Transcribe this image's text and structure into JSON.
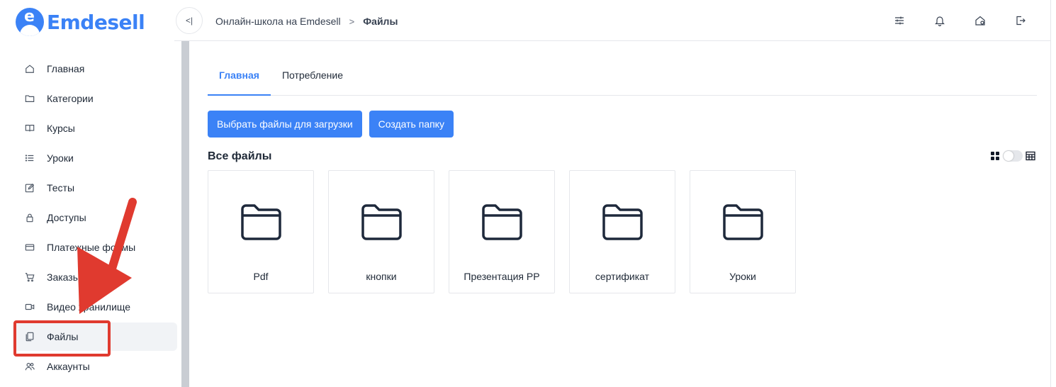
{
  "app": {
    "logo_text": "Emdesell",
    "logo_letter": "e"
  },
  "header": {
    "collapse_label": "<|",
    "breadcrumb": [
      "Онлайн-школа на Emdesell",
      "Файлы"
    ],
    "breadcrumb_sep": ">",
    "icons": [
      "sliders-icon",
      "bell-icon",
      "home-settings-icon",
      "logout-icon"
    ]
  },
  "sidebar": {
    "items": [
      {
        "label": "Главная",
        "icon": "home-icon"
      },
      {
        "label": "Категории",
        "icon": "folder-icon"
      },
      {
        "label": "Курсы",
        "icon": "book-icon"
      },
      {
        "label": "Уроки",
        "icon": "list-icon"
      },
      {
        "label": "Тесты",
        "icon": "edit-icon"
      },
      {
        "label": "Доступы",
        "icon": "lock-icon"
      },
      {
        "label": "Платежные формы",
        "icon": "credit-card-icon"
      },
      {
        "label": "Заказы",
        "icon": "cart-icon"
      },
      {
        "label": "Видео хранилище",
        "icon": "video-icon"
      },
      {
        "label": "Файлы",
        "icon": "files-icon",
        "active": true
      },
      {
        "label": "Аккаунты",
        "icon": "users-icon"
      }
    ]
  },
  "main": {
    "tabs": [
      {
        "label": "Главная",
        "active": true
      },
      {
        "label": "Потребление",
        "active": false
      }
    ],
    "buttons": {
      "upload": "Выбрать файлы для загрузки",
      "create_folder": "Создать папку"
    },
    "section_title": "Все файлы",
    "folders": [
      "Pdf",
      "кнопки",
      "Презентация PP",
      "сертификат",
      "Уроки"
    ]
  },
  "colors": {
    "accent": "#3b82f6",
    "annotation": "#e03a2f",
    "active_bg": "#f1f3f6"
  }
}
